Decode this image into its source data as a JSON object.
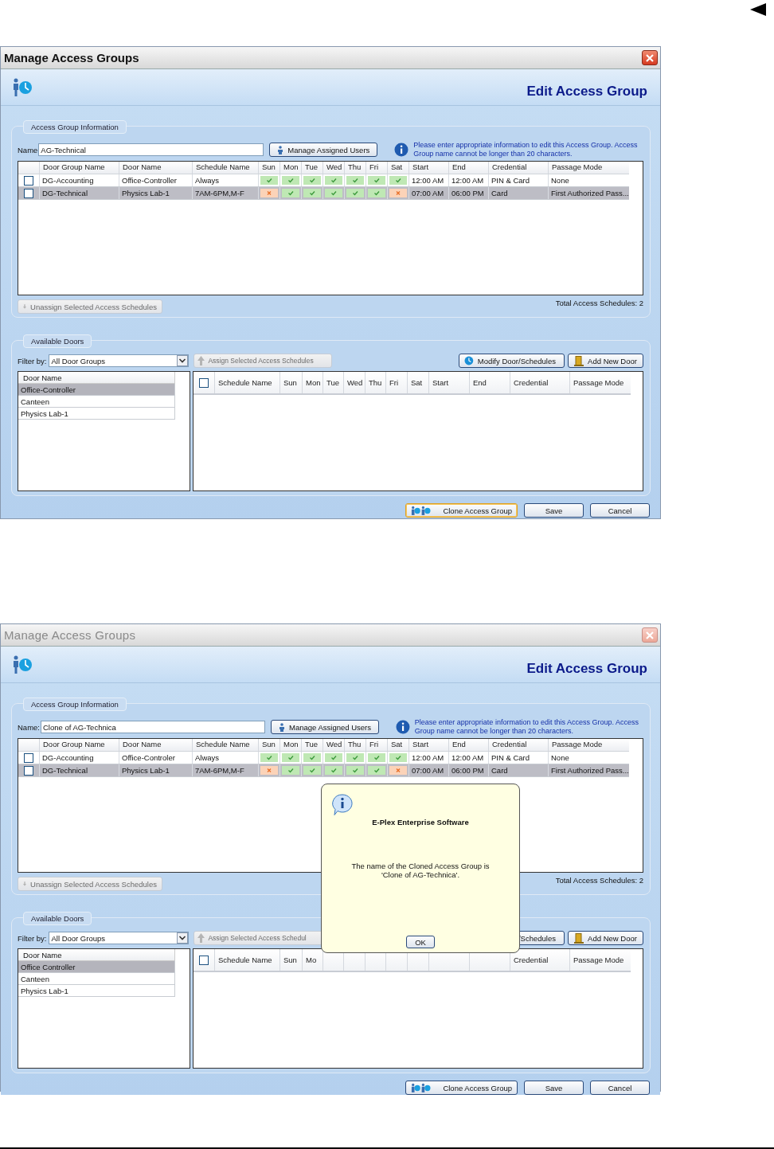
{
  "windows": [
    {
      "title": "Manage Access Groups",
      "active": true,
      "heading": "Edit Access Group",
      "group_info": {
        "legend": "Access Group Information",
        "name_label": "Name",
        "name_value": "AG-Technical",
        "manage_button": "Manage Assigned Users",
        "info": "Please enter appropriate information to edit this Access Group. Access Group name cannot be longer than 20 characters."
      },
      "table": {
        "columns": [
          "Door Group Name",
          "Door Name",
          "Schedule Name",
          "Sun",
          "Mon",
          "Tue",
          "Wed",
          "Thu",
          "Fri",
          "Sat",
          "Start",
          "End",
          "Credential",
          "Passage Mode"
        ],
        "rows": [
          {
            "selected": false,
            "checked": false,
            "cells": [
              "DG-Accounting",
              "Office-Controller",
              "Always"
            ],
            "days": [
              {
                "on": true
              },
              {
                "on": true
              },
              {
                "on": true
              },
              {
                "on": true
              },
              {
                "on": true
              },
              {
                "on": true
              },
              {
                "on": true
              }
            ],
            "tail": [
              "12:00 AM",
              "12:00 AM",
              "PIN & Card",
              "None"
            ]
          },
          {
            "selected": true,
            "checked": false,
            "cells": [
              "DG-Technical",
              "Physics Lab-1",
              "7AM-6PM,M-F"
            ],
            "days": [
              {
                "on": false
              },
              {
                "on": true
              },
              {
                "on": true
              },
              {
                "on": true
              },
              {
                "on": true
              },
              {
                "on": true
              },
              {
                "on": false
              }
            ],
            "tail": [
              "07:00 AM",
              "06:00 PM",
              "Card",
              "First Authorized Pass..."
            ]
          }
        ]
      },
      "unassign_button": {
        "label": "Unassign Selected Access Schedules",
        "disabled": true
      },
      "total": "Total Access Schedules: 2",
      "available": {
        "legend": "Available Doors",
        "filter_label": "Filter by:",
        "filter_value": "All Door Groups",
        "assign_button": {
          "label": "Assign Selected Access Schedules",
          "disabled": true
        },
        "modify_button": {
          "label": "Modify Door/Schedules",
          "kind": "full"
        },
        "add_button": "Add New Door",
        "door_header": "Door Name",
        "header_checked": false,
        "doors": [
          {
            "label": "Office-Controller",
            "selected": true
          },
          {
            "label": "Canteen",
            "selected": false
          },
          {
            "label": "Physics Lab-1",
            "selected": false
          }
        ],
        "schedule_columns": [
          {
            "label": "Schedule Name"
          },
          {
            "label": "Sun"
          },
          {
            "label": "Mon"
          },
          {
            "label": "Tue"
          },
          {
            "label": "Wed"
          },
          {
            "label": "Thu"
          },
          {
            "label": "Fri"
          },
          {
            "label": "Sat"
          },
          {
            "label": "Start"
          },
          {
            "label": "End"
          },
          {
            "label": "Credential"
          },
          {
            "label": "Passage Mode"
          }
        ]
      },
      "footer": {
        "clone": {
          "label": "Clone Access Group",
          "focused": true
        },
        "save": "Save",
        "cancel": "Cancel"
      }
    },
    {
      "title": "Manage Access Groups",
      "active": false,
      "heading": "Edit Access Group",
      "group_info": {
        "legend": "Access Group Information",
        "name_label": "Name:",
        "name_value": "Clone of AG-Technica",
        "manage_button": "Manage Assigned Users",
        "info": "Please enter appropriate information to edit this Access Group. Access Group name cannot be longer than 20 characters."
      },
      "table": {
        "columns": [
          "Door Group Name",
          "Door Name",
          "Schedule Name",
          "Sun",
          "Mon",
          "Tue",
          "Wed",
          "Thu",
          "Fri",
          "Sat",
          "Start",
          "End",
          "Credential",
          "Passage Mode"
        ],
        "rows": [
          {
            "selected": false,
            "checked": false,
            "cells": [
              "DG-Accounting",
              "Office-Controler",
              "Always"
            ],
            "days": [
              {
                "on": true
              },
              {
                "on": true
              },
              {
                "on": true
              },
              {
                "on": true
              },
              {
                "on": true
              },
              {
                "on": true
              },
              {
                "on": true
              }
            ],
            "tail": [
              "12:00 AM",
              "12:00 AM",
              "PIN & Card",
              "None"
            ]
          },
          {
            "selected": true,
            "checked": false,
            "cells": [
              "DG-Technical",
              "Physics Lab-1",
              "7AM-6PM,M-F"
            ],
            "days": [
              {
                "on": false
              },
              {
                "on": true
              },
              {
                "on": true
              },
              {
                "on": true
              },
              {
                "on": true
              },
              {
                "on": true
              },
              {
                "on": false
              }
            ],
            "tail": [
              "07:00 AM",
              "06:00 PM",
              "Card",
              "First Authorized Pass..."
            ]
          }
        ]
      },
      "unassign_button": {
        "label": "Unassign Selected Access Schedules",
        "disabled": true
      },
      "total": "Total Access Schedules: 2",
      "available": {
        "legend": "Available Doors",
        "filter_label": "Filter by:",
        "filter_value": "All Door Groups",
        "assign_button": {
          "label": "Assign Selected Access Schedul",
          "disabled": true
        },
        "modify_button": {
          "label": "/Schedules",
          "kind": "tail"
        },
        "add_button": "Add New Door",
        "door_header": "Door Name",
        "header_checked": false,
        "doors": [
          {
            "label": "Office Controller",
            "selected": true
          },
          {
            "label": "Canteen",
            "selected": false
          },
          {
            "label": "Physics Lab-1",
            "selected": false
          }
        ],
        "schedule_columns": [
          {
            "label": "Schedule Name"
          },
          {
            "label": "Sun"
          },
          {
            "label": "Mo"
          },
          {},
          {},
          {},
          {},
          {},
          {},
          {},
          {
            "label": "Credential"
          },
          {
            "label": "Passage Mode"
          }
        ]
      },
      "footer": {
        "clone": {
          "label": "Clone Access Group",
          "focused": false
        },
        "save": "Save",
        "cancel": "Cancel"
      },
      "dialog": {
        "title": "E-Plex Enterprise Software",
        "message": "The name of the Cloned Access Group is 'Clone of AG-Technica'.",
        "ok": "OK"
      }
    }
  ]
}
